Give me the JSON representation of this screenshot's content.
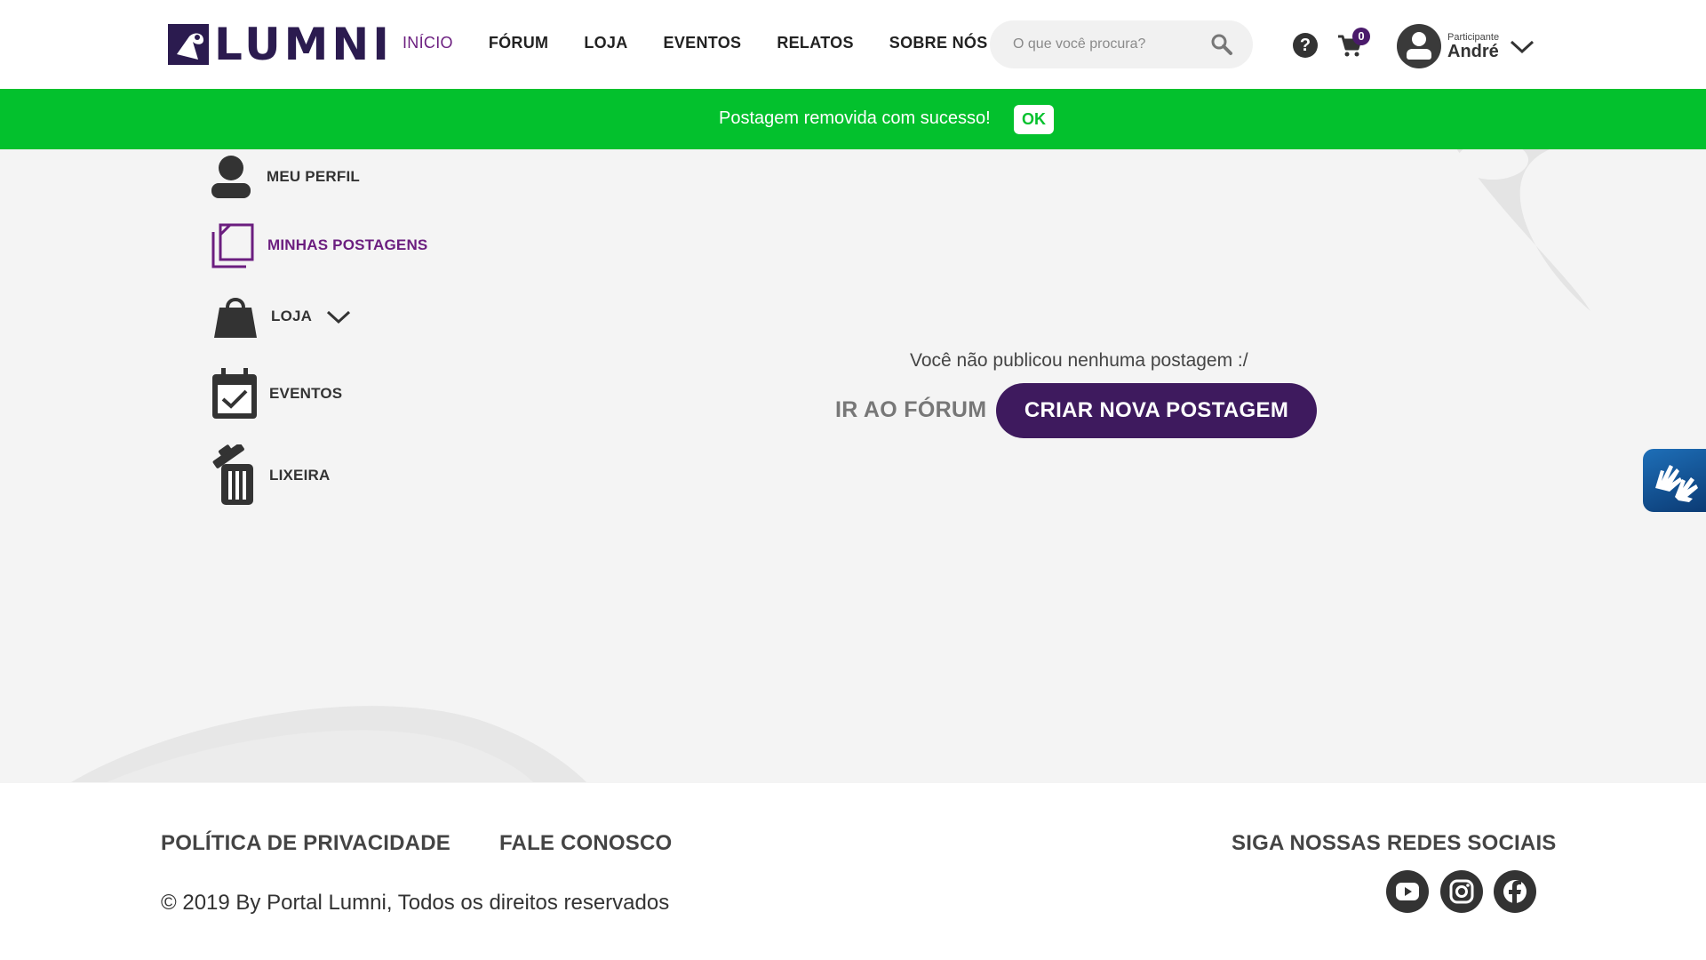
{
  "header": {
    "logo_text": "LUMNI",
    "nav": [
      {
        "label": "INÍCIO",
        "active": true
      },
      {
        "label": "FÓRUM",
        "active": false
      },
      {
        "label": "LOJA",
        "active": false
      },
      {
        "label": "EVENTOS",
        "active": false
      },
      {
        "label": "RELATOS",
        "active": false
      },
      {
        "label": "SOBRE NÓS",
        "active": false
      }
    ],
    "search_placeholder": "O que você procura?",
    "help_label": "?",
    "cart_count": "0",
    "user_role": "Participante",
    "user_name": "André"
  },
  "banner": {
    "message": "Postagem removida com sucesso!",
    "ok_label": "OK",
    "color": "#03c12d"
  },
  "sidebar": {
    "items": [
      {
        "label": "MEU PERFIL",
        "icon": "user-icon"
      },
      {
        "label": "MINHAS POSTAGENS",
        "icon": "posts-icon",
        "active": true
      },
      {
        "label": "LOJA",
        "icon": "shopping-bag-icon"
      },
      {
        "label": "EVENTOS",
        "icon": "calendar-check-icon"
      },
      {
        "label": "LIXEIRA",
        "icon": "trash-icon"
      }
    ]
  },
  "main": {
    "empty_message": "Você não publicou nenhuma postagem :/",
    "forum_link": "IR AO FÓRUM",
    "create_button": "CRIAR NOVA POSTAGEM"
  },
  "footer": {
    "privacy": "POLÍTICA DE PRIVACIDADE",
    "contact": "FALE CONOSCO",
    "copyright": "© 2019 By Portal Lumni, Todos os direitos reservados",
    "social_title": "SIGA NOSSAS REDES SOCIAIS",
    "social": [
      "youtube-icon",
      "instagram-icon",
      "facebook-icon"
    ]
  },
  "colors": {
    "brand": "#6b1e7f",
    "button": "#3e1a5e",
    "success": "#03c12d"
  }
}
